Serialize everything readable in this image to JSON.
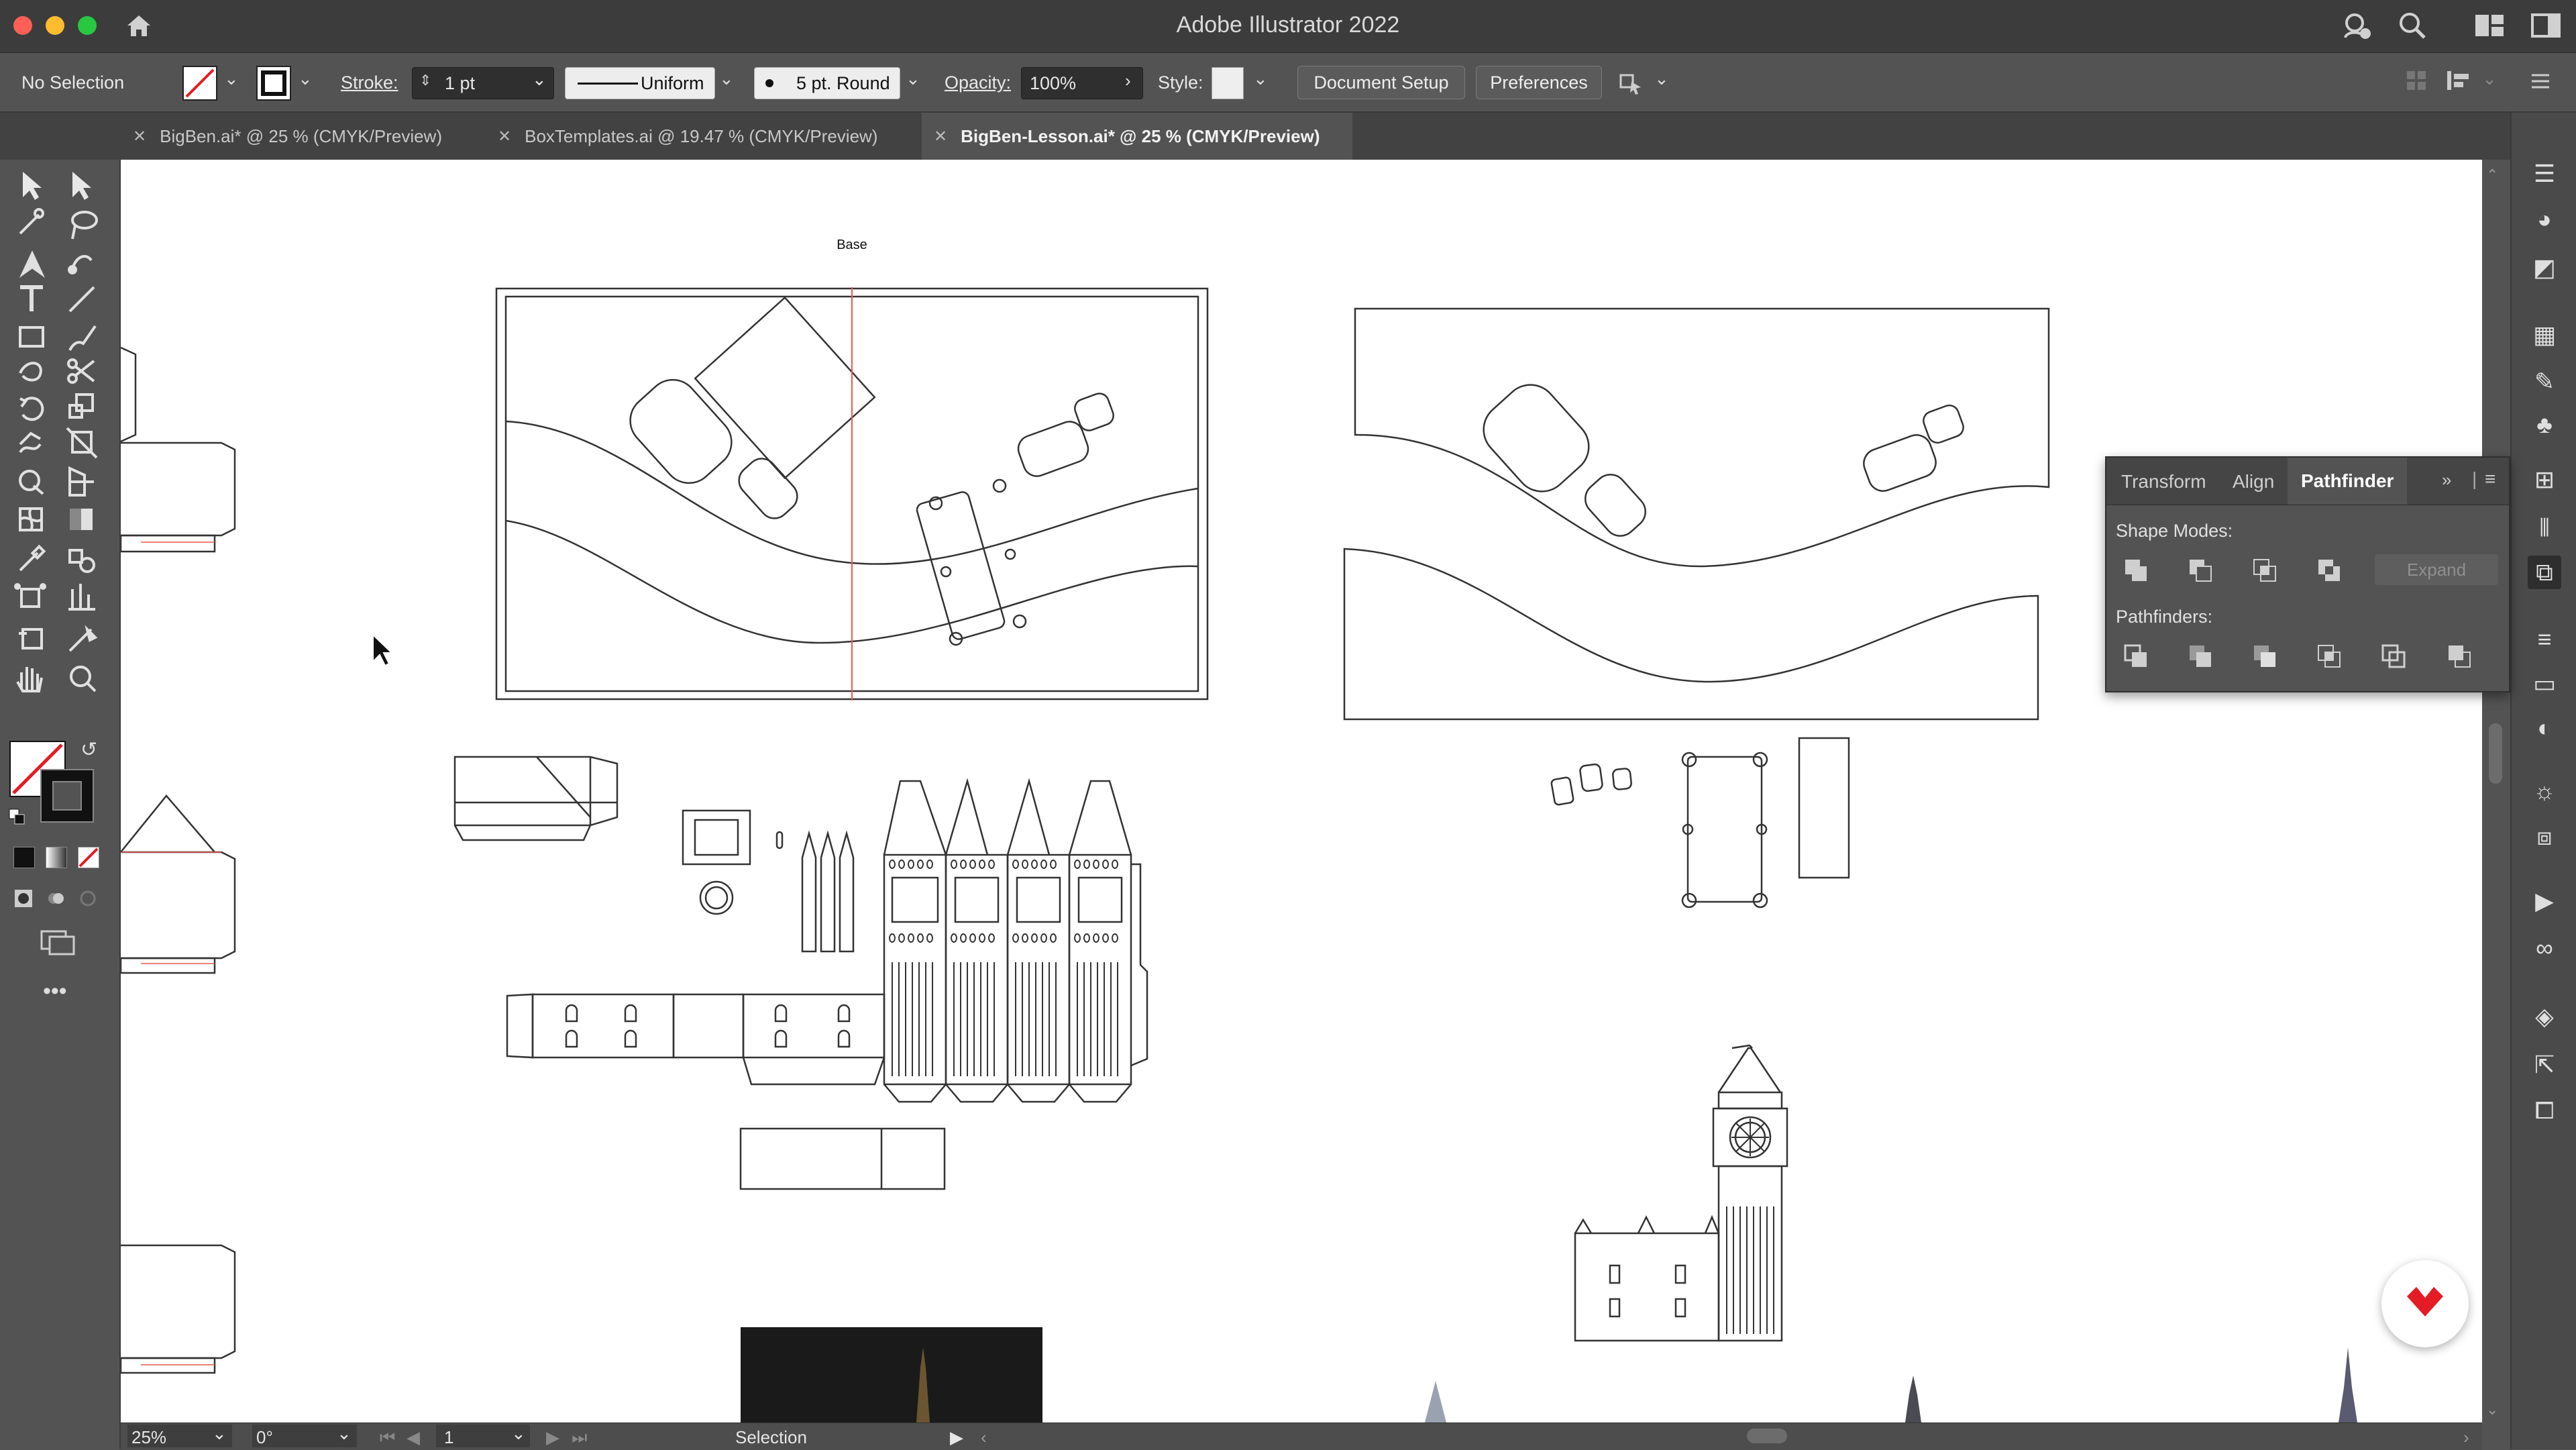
{
  "window": {
    "title": "Adobe Illustrator 2022"
  },
  "controlbar": {
    "selection": "No Selection",
    "stroke_label": "Stroke:",
    "stroke_value": "1 pt",
    "stroke_profile": "Uniform",
    "brush": "5 pt. Round",
    "opacity_label": "Opacity:",
    "opacity_value": "100%",
    "style_label": "Style:",
    "document_setup": "Document Setup",
    "preferences": "Preferences"
  },
  "tabs": [
    {
      "label": "BigBen.ai* @ 25 % (CMYK/Preview)",
      "active": false
    },
    {
      "label": "BoxTemplates.ai @ 19.47 % (CMYK/Preview)",
      "active": false
    },
    {
      "label": "BigBen-Lesson.ai* @ 25 % (CMYK/Preview)",
      "active": true
    }
  ],
  "artboard": {
    "base_label": "Base"
  },
  "pathfinder": {
    "tabs": [
      "Transform",
      "Align",
      "Pathfinder"
    ],
    "shape_modes_label": "Shape Modes:",
    "expand_label": "Expand",
    "pathfinders_label": "Pathfinders:"
  },
  "statusbar": {
    "zoom": "25%",
    "rotation": "0°",
    "artboard_number": "1",
    "tool_name": "Selection"
  },
  "colors": {
    "accent_red": "#e31c25",
    "guide_red": "#e8594f"
  }
}
